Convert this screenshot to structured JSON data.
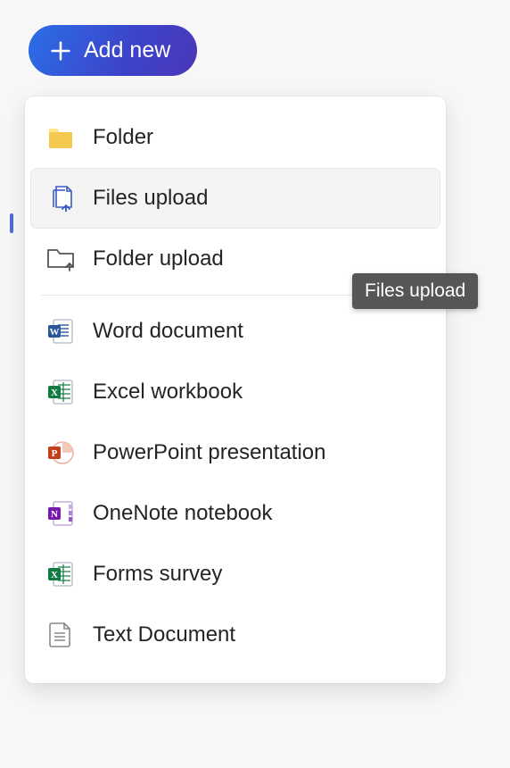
{
  "button": {
    "label": "Add new"
  },
  "menu": {
    "items": [
      {
        "label": "Folder",
        "icon": "folder-icon"
      },
      {
        "label": "Files upload",
        "icon": "files-upload-icon",
        "hovered": true
      },
      {
        "label": "Folder upload",
        "icon": "folder-upload-icon"
      },
      {
        "label": "Word document",
        "icon": "word-icon"
      },
      {
        "label": "Excel workbook",
        "icon": "excel-icon"
      },
      {
        "label": "PowerPoint presentation",
        "icon": "powerpoint-icon"
      },
      {
        "label": "OneNote notebook",
        "icon": "onenote-icon"
      },
      {
        "label": "Forms survey",
        "icon": "forms-icon"
      },
      {
        "label": "Text Document",
        "icon": "text-doc-icon"
      }
    ]
  },
  "tooltip": {
    "text": "Files upload"
  },
  "colors": {
    "accent": "#3d43c9",
    "word": "#2a579a",
    "excel": "#107c41",
    "ppt": "#c43e1c",
    "onenote": "#7719aa",
    "folder": "#f3c94f",
    "text": "#888888"
  }
}
